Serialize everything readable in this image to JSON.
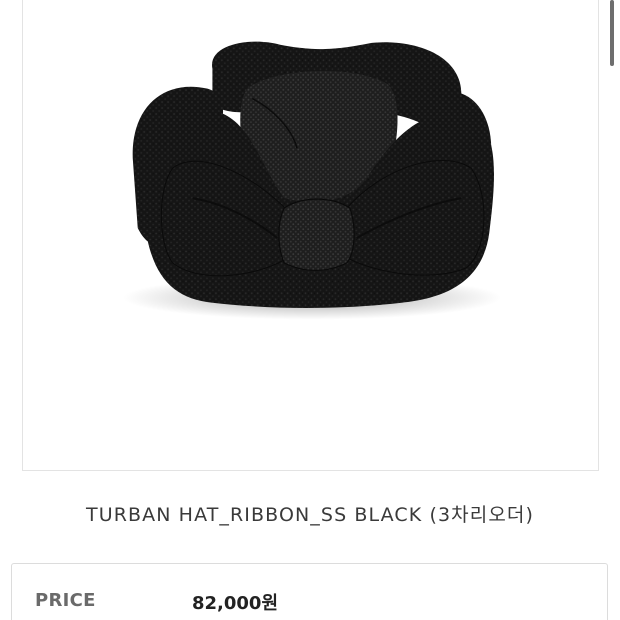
{
  "product": {
    "image_alt": "black knitted turban hat with ribbon",
    "title": "TURBAN HAT_RIBBON_SS BLACK (3차리오더)"
  },
  "price": {
    "label": "PRICE",
    "value": "82,000원"
  },
  "colors": {
    "hat": "#141414",
    "border": "#e3e3e3"
  }
}
